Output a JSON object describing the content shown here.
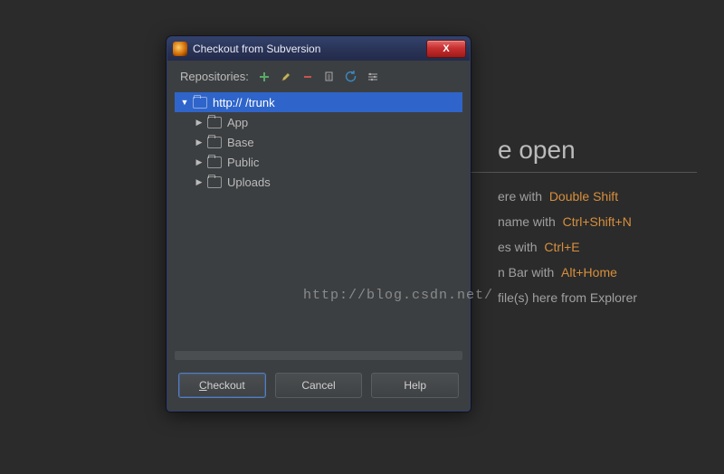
{
  "welcome": {
    "title_fragment": "e open",
    "lines": [
      {
        "text_fragment": "ere with",
        "shortcut": "Double Shift"
      },
      {
        "text_fragment": "name with",
        "shortcut": "Ctrl+Shift+N"
      },
      {
        "text_fragment": "es with",
        "shortcut": "Ctrl+E"
      },
      {
        "text_fragment": "n Bar with",
        "shortcut": "Alt+Home"
      },
      {
        "text_fragment": "file(s) here from Explorer",
        "shortcut": ""
      }
    ]
  },
  "dialog": {
    "title": "Checkout from Subversion",
    "close_label": "X",
    "toolbar_label": "Repositories:",
    "tree": {
      "root": "http://                              /trunk",
      "children": [
        "App",
        "Base",
        "Public",
        "Uploads"
      ]
    },
    "buttons": {
      "checkout": "Checkout",
      "cancel": "Cancel",
      "help": "Help"
    }
  },
  "watermark": "http://blog.csdn.net/"
}
